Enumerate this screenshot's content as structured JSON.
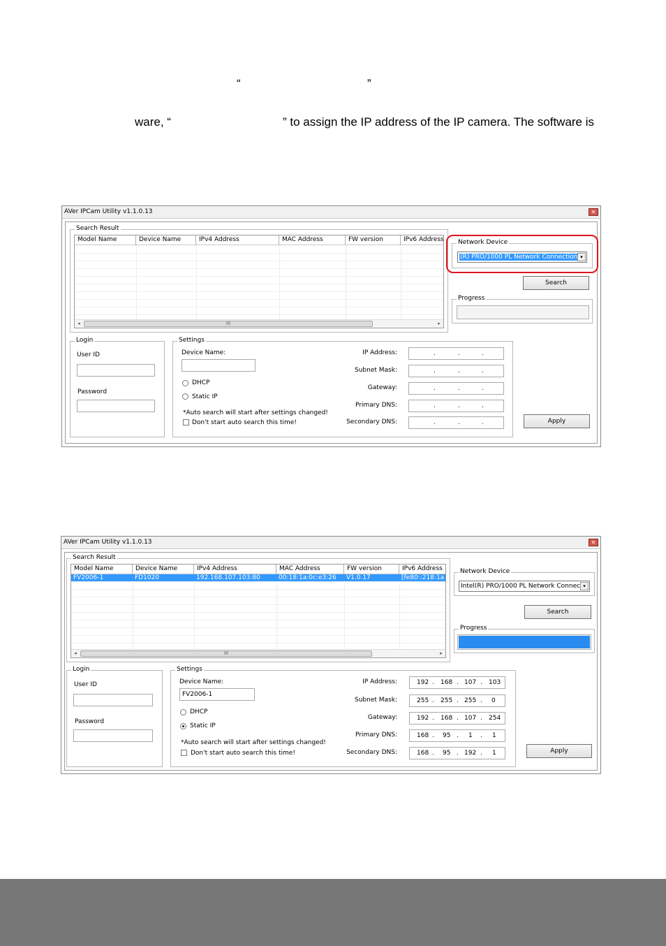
{
  "doc": {
    "line1_open_quote": "“",
    "line1_close_quote": "”",
    "line2_prefix": "ware, “",
    "line2_suffix": "” to assign the IP address of the IP camera. The software is"
  },
  "app": {
    "title": "AVer IPCam Utility v1.1.0.13",
    "close_icon": "close-icon",
    "labels": {
      "search_result": "Search Result",
      "network_device": "Network Device",
      "progress": "Progress",
      "login": "Login",
      "user_id": "User ID",
      "password": "Password",
      "settings": "Settings",
      "device_name": "Device Name:",
      "dhcp": "DHCP",
      "static_ip": "Static IP",
      "auto_note": "*Auto search will start after settings changed!",
      "dont_start": "Don't start auto search this time!",
      "ip_address": "IP Address:",
      "subnet_mask": "Subnet Mask:",
      "gateway": "Gateway:",
      "primary_dns": "Primary DNS:",
      "secondary_dns": "Secondary DNS:",
      "search_button": "Search",
      "apply_button": "Apply",
      "scroll_grip": "III",
      "scroll_left": "◂",
      "scroll_right": "▸",
      "drop_arrow": "▾"
    },
    "columns": [
      "Model Name",
      "Device Name",
      "IPv4 Address",
      "MAC Address",
      "FW version",
      "IPv6 Address"
    ]
  },
  "window1": {
    "network_device_value": "(R) PRO/1000 PL Network Connection",
    "device_name_value": "",
    "ip_empty": [
      ".",
      ".",
      "."
    ],
    "dhcp_selected": false,
    "static_selected": false,
    "dont_start_checked": false,
    "progress_fraction": 0
  },
  "window2": {
    "network_device_value": "Intel(R) PRO/1000 PL Network Connec",
    "device_name_value": "FV2006-1",
    "row": [
      "FV2006-1",
      "FD1020",
      "192.168.107.103:80",
      "00:18:1a:0c:e3:26",
      "V1.0.17",
      "[fe80::218:1a"
    ],
    "ip_address": [
      "192",
      "168",
      "107",
      "103"
    ],
    "subnet_mask": [
      "255",
      "255",
      "255",
      "0"
    ],
    "gateway": [
      "192",
      "168",
      "107",
      "254"
    ],
    "primary_dns": [
      "168",
      "95",
      "1",
      "1"
    ],
    "secondary_dns": [
      "168",
      "95",
      "192",
      "1"
    ],
    "dot": ".",
    "dhcp_selected": false,
    "static_selected": true,
    "dont_start_checked": false,
    "progress_fraction": 1
  }
}
